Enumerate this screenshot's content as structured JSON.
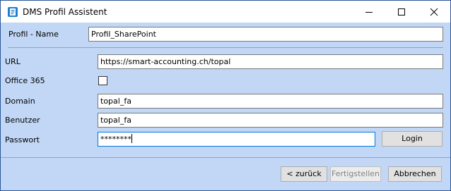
{
  "window": {
    "title": "DMS Profil Assistent",
    "controls": [
      "minimize-icon",
      "maximize-icon",
      "close-icon"
    ]
  },
  "form": {
    "profile_name_label": "Profil - Name",
    "profile_name_value": "Profil_SharePoint",
    "url_label": "URL",
    "url_value": "https://smart-accounting.ch/topal",
    "office365_label": "Office 365",
    "office365_checked": false,
    "domain_label": "Domain",
    "domain_value": "topal_fa",
    "user_label": "Benutzer",
    "user_value": "topal_fa",
    "password_label": "Passwort",
    "password_value": "********",
    "login_label": "Login"
  },
  "footer": {
    "back_label": "< zurück",
    "finish_label": "Fertigstellen",
    "cancel_label": "Abbrechen"
  },
  "colors": {
    "background": "#c1d7f5",
    "accent": "#0078d7"
  }
}
